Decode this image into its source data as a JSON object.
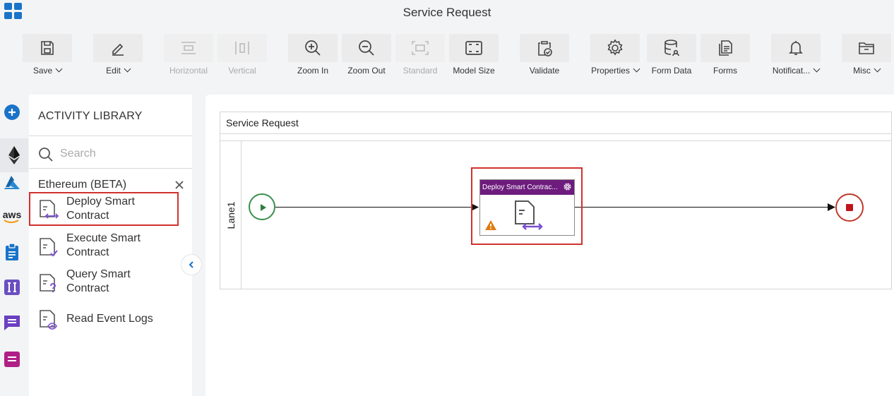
{
  "header": {
    "title": "Service Request"
  },
  "toolbar": {
    "save": "Save",
    "edit": "Edit",
    "horizontal": "Horizontal",
    "vertical": "Vertical",
    "zoom_in": "Zoom In",
    "zoom_out": "Zoom Out",
    "standard": "Standard",
    "model_size": "Model Size",
    "validate": "Validate",
    "properties": "Properties",
    "form_data": "Form Data",
    "forms": "Forms",
    "notifications": "Notificat...",
    "misc": "Misc"
  },
  "rail": {
    "icons": [
      "add-icon",
      "ethereum-icon",
      "azure-icon",
      "aws-icon",
      "clipboard-icon",
      "integration-icon",
      "message-icon",
      "document-icon"
    ],
    "aws_text": "aws"
  },
  "library": {
    "title": "ACTIVITY LIBRARY",
    "search_placeholder": "Search",
    "category": "Ethereum (BETA)",
    "items": [
      {
        "label": "Deploy Smart Contract",
        "icon": "deploy-contract-icon",
        "selected": true
      },
      {
        "label": "Execute Smart Contract",
        "icon": "execute-contract-icon",
        "selected": false
      },
      {
        "label": "Query Smart Contract",
        "icon": "query-contract-icon",
        "selected": false
      },
      {
        "label": "Read Event Logs",
        "icon": "read-event-logs-icon",
        "selected": false
      }
    ]
  },
  "canvas": {
    "pool_title": "Service Request",
    "lane_label": "Lane1",
    "task_title": "Deploy Smart Contrac...",
    "task_warning": true
  },
  "colors": {
    "accent": "#1a73c8",
    "task_header": "#6d1c7d",
    "selection": "#d0312d",
    "start": "#3a8f4d",
    "end": "#c0392b"
  }
}
